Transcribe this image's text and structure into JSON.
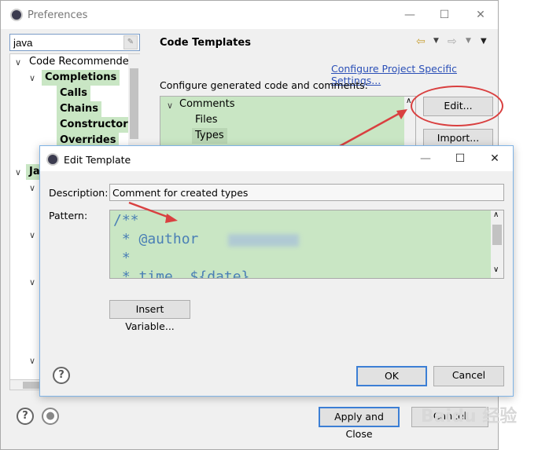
{
  "preferences": {
    "title": "Preferences",
    "search_value": "java",
    "tree": [
      {
        "label": "Code Recommenders",
        "expanded": true
      },
      {
        "label": "Completions",
        "highlighted": true
      },
      {
        "label": "Calls",
        "highlighted": true
      },
      {
        "label": "Chains",
        "highlighted": true
      },
      {
        "label": "Constructors",
        "highlighted": true
      },
      {
        "label": "Overrides",
        "highlighted": true
      },
      {
        "label": "Java"
      }
    ],
    "page_title": "Code Templates",
    "configure_link": "Configure Project Specific Settings...",
    "configure_desc": "Configure generated code and comments:",
    "template_tree": {
      "comments": "Comments",
      "files": "Files",
      "types": "Types"
    },
    "edit_button": "Edit...",
    "import_button": "Import...",
    "apply_close_button": "Apply and Close",
    "cancel_button": "Cancel"
  },
  "edit_template": {
    "title": "Edit Template",
    "description_label": "Description:",
    "description_value": "Comment for created types",
    "pattern_label": "Pattern:",
    "pattern_lines": [
      "/**",
      " * @author",
      " *",
      " * time  ${date}"
    ],
    "insert_variable_button": "Insert Variable...",
    "ok_button": "OK",
    "cancel_button": "Cancel"
  },
  "watermark": "Baidu 经验",
  "colors": {
    "highlight": "#c9e6c4",
    "link": "#2a4fb7",
    "annotation": "#d94040",
    "focus": "#3c7fd5"
  }
}
